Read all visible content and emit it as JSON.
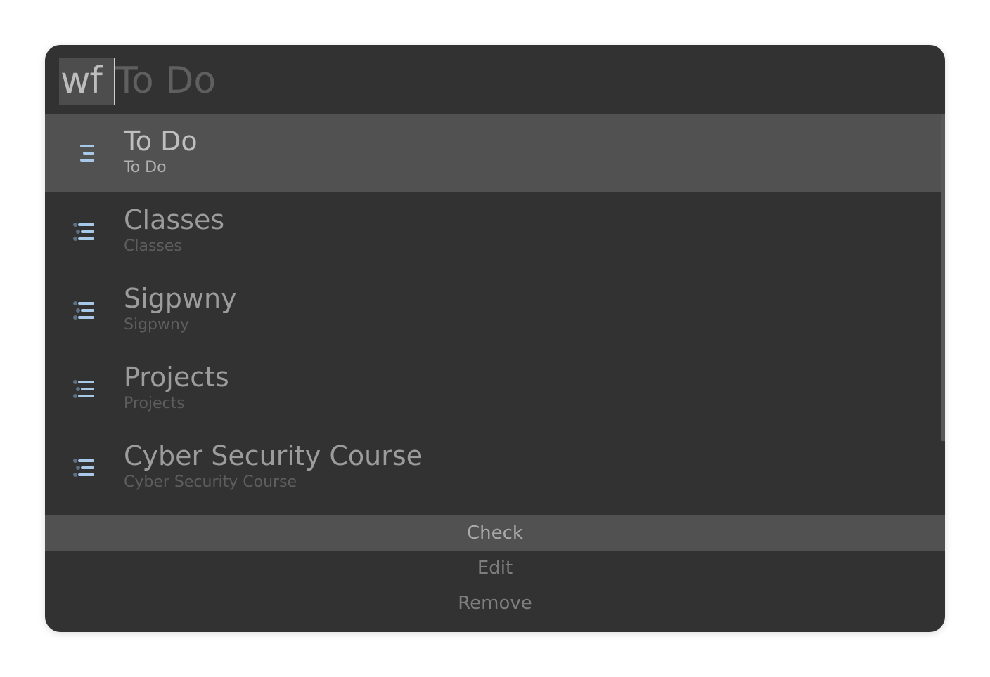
{
  "search": {
    "keyword": "wf",
    "completion": "To Do"
  },
  "results": [
    {
      "title": "To Do",
      "subtitle": "To Do",
      "icon": "list-indent-icon",
      "selected": true
    },
    {
      "title": "Classes",
      "subtitle": "Classes",
      "icon": "list-indent-icon",
      "selected": false
    },
    {
      "title": "Sigpwny",
      "subtitle": "Sigpwny",
      "icon": "list-indent-icon",
      "selected": false
    },
    {
      "title": "Projects",
      "subtitle": "Projects",
      "icon": "list-indent-icon",
      "selected": false
    },
    {
      "title": "Cyber Security Course",
      "subtitle": "Cyber Security Course",
      "icon": "list-indent-icon",
      "selected": false
    }
  ],
  "actions": [
    {
      "label": "Check",
      "selected": true
    },
    {
      "label": "Edit",
      "selected": false
    },
    {
      "label": "Remove",
      "selected": false
    }
  ],
  "colors": {
    "background": "#323232",
    "selection": "#515151",
    "icon_accent": "#a8c8e8",
    "icon_bullet": "#5f7080"
  }
}
